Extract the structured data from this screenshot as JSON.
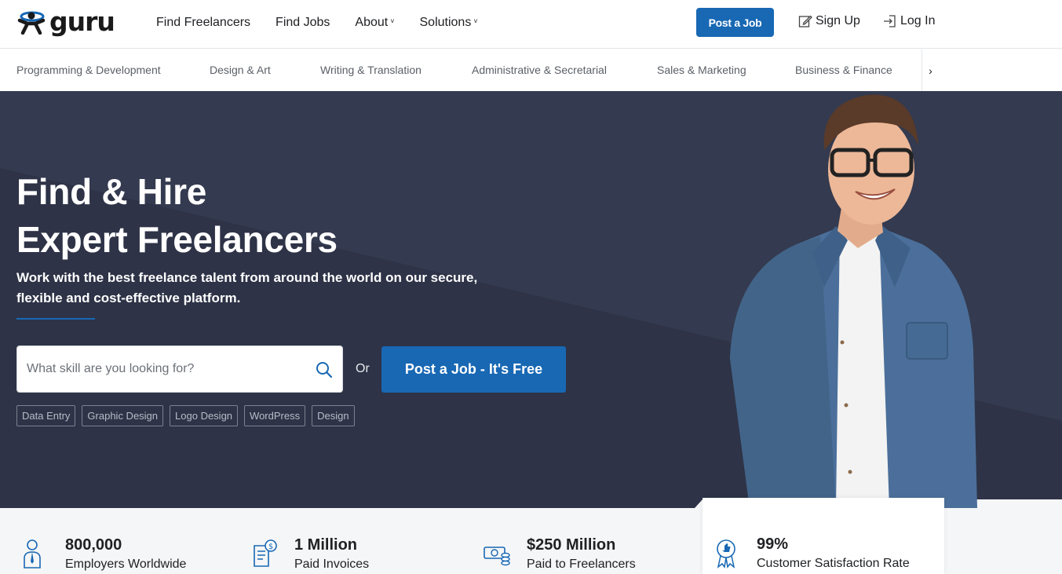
{
  "brand": {
    "logo_text": "guru",
    "accent": "#1868b4",
    "hero_bg": "#2e3347"
  },
  "nav": {
    "find_freelancers": "Find Freelancers",
    "find_jobs": "Find Jobs",
    "about": "About",
    "solutions": "Solutions",
    "post_job": "Post a Job",
    "sign_up": "Sign Up",
    "log_in": "Log In"
  },
  "categories": [
    "Programming & Development",
    "Design & Art",
    "Writing & Translation",
    "Administrative & Secretarial",
    "Sales & Marketing",
    "Business & Finance"
  ],
  "hero": {
    "title_line1": "Find & Hire",
    "title_line2": "Expert Freelancers",
    "subtitle": "Work with the best freelance talent from around the world on our secure, flexible and cost-effective platform.",
    "search_placeholder": "What skill are you looking for?",
    "or": "Or",
    "cta": "Post a Job - It's Free",
    "chips": [
      "Data Entry",
      "Graphic Design",
      "Logo Design",
      "WordPress",
      "Design"
    ]
  },
  "stats": [
    {
      "value": "800,000",
      "label": "Employers Worldwide",
      "icon": "employer-icon"
    },
    {
      "value": "1 Million",
      "label": "Paid Invoices",
      "icon": "invoice-icon"
    },
    {
      "value": "$250 Million",
      "label": "Paid to Freelancers",
      "icon": "money-icon"
    },
    {
      "value": "99%",
      "label": "Customer Satisfaction Rate",
      "icon": "award-icon"
    }
  ]
}
